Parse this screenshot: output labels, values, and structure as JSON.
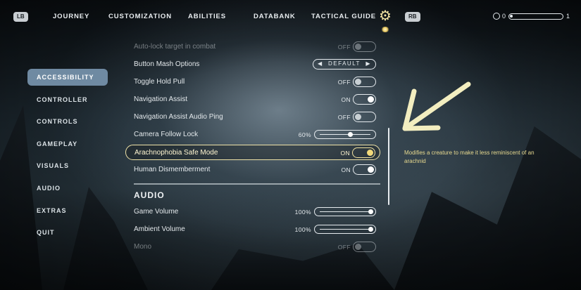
{
  "topbar": {
    "lb": "LB",
    "rb": "RB",
    "tabs": [
      "JOURNEY",
      "CUSTOMIZATION",
      "ABILITIES",
      "DATABANK",
      "TACTICAL GUIDE"
    ],
    "ammo_left": "0",
    "ammo_right": "1",
    "ammo_fill_fraction": 0.05
  },
  "sidebar": {
    "items": [
      {
        "label": "ACCESSIBILITY",
        "active": true
      },
      {
        "label": "CONTROLLER"
      },
      {
        "label": "CONTROLS"
      },
      {
        "label": "GAMEPLAY"
      },
      {
        "label": "VISUALS"
      },
      {
        "label": "AUDIO"
      },
      {
        "label": "EXTRAS"
      },
      {
        "label": "QUIT"
      }
    ]
  },
  "settings": [
    {
      "label": "Auto-lock target in combat",
      "type": "toggle",
      "value": "OFF",
      "on": false,
      "faded": true
    },
    {
      "label": "Button Mash Options",
      "type": "selector",
      "value": "DEFAULT"
    },
    {
      "label": "Toggle Hold Pull",
      "type": "toggle",
      "value": "OFF",
      "on": false
    },
    {
      "label": "Navigation Assist",
      "type": "toggle",
      "value": "ON",
      "on": true
    },
    {
      "label": "Navigation Assist Audio Ping",
      "type": "toggle",
      "value": "OFF",
      "on": false
    },
    {
      "label": "Camera Follow Lock",
      "type": "slider",
      "value": "60%",
      "level": 0.6
    },
    {
      "label": "Arachnophobia Safe Mode",
      "type": "toggle",
      "value": "ON",
      "on": true,
      "highlight": true
    },
    {
      "label": "Human Dismemberment",
      "type": "toggle",
      "value": "ON",
      "on": true
    }
  ],
  "audio_section": {
    "title": "AUDIO",
    "settings": [
      {
        "label": "Game Volume",
        "type": "slider",
        "value": "100%",
        "level": 1.0
      },
      {
        "label": "Ambient Volume",
        "type": "slider",
        "value": "100%",
        "level": 1.0
      },
      {
        "label": "Mono",
        "type": "toggle",
        "value": "OFF",
        "on": false,
        "faded": true
      }
    ]
  },
  "description": "Modifies a creature to make it less reminiscent of an arachnid",
  "colors": {
    "accent": "#efe3a8",
    "active_tab_bg": "#6f8aa2",
    "annotation_arrow": "#f3eec0"
  }
}
